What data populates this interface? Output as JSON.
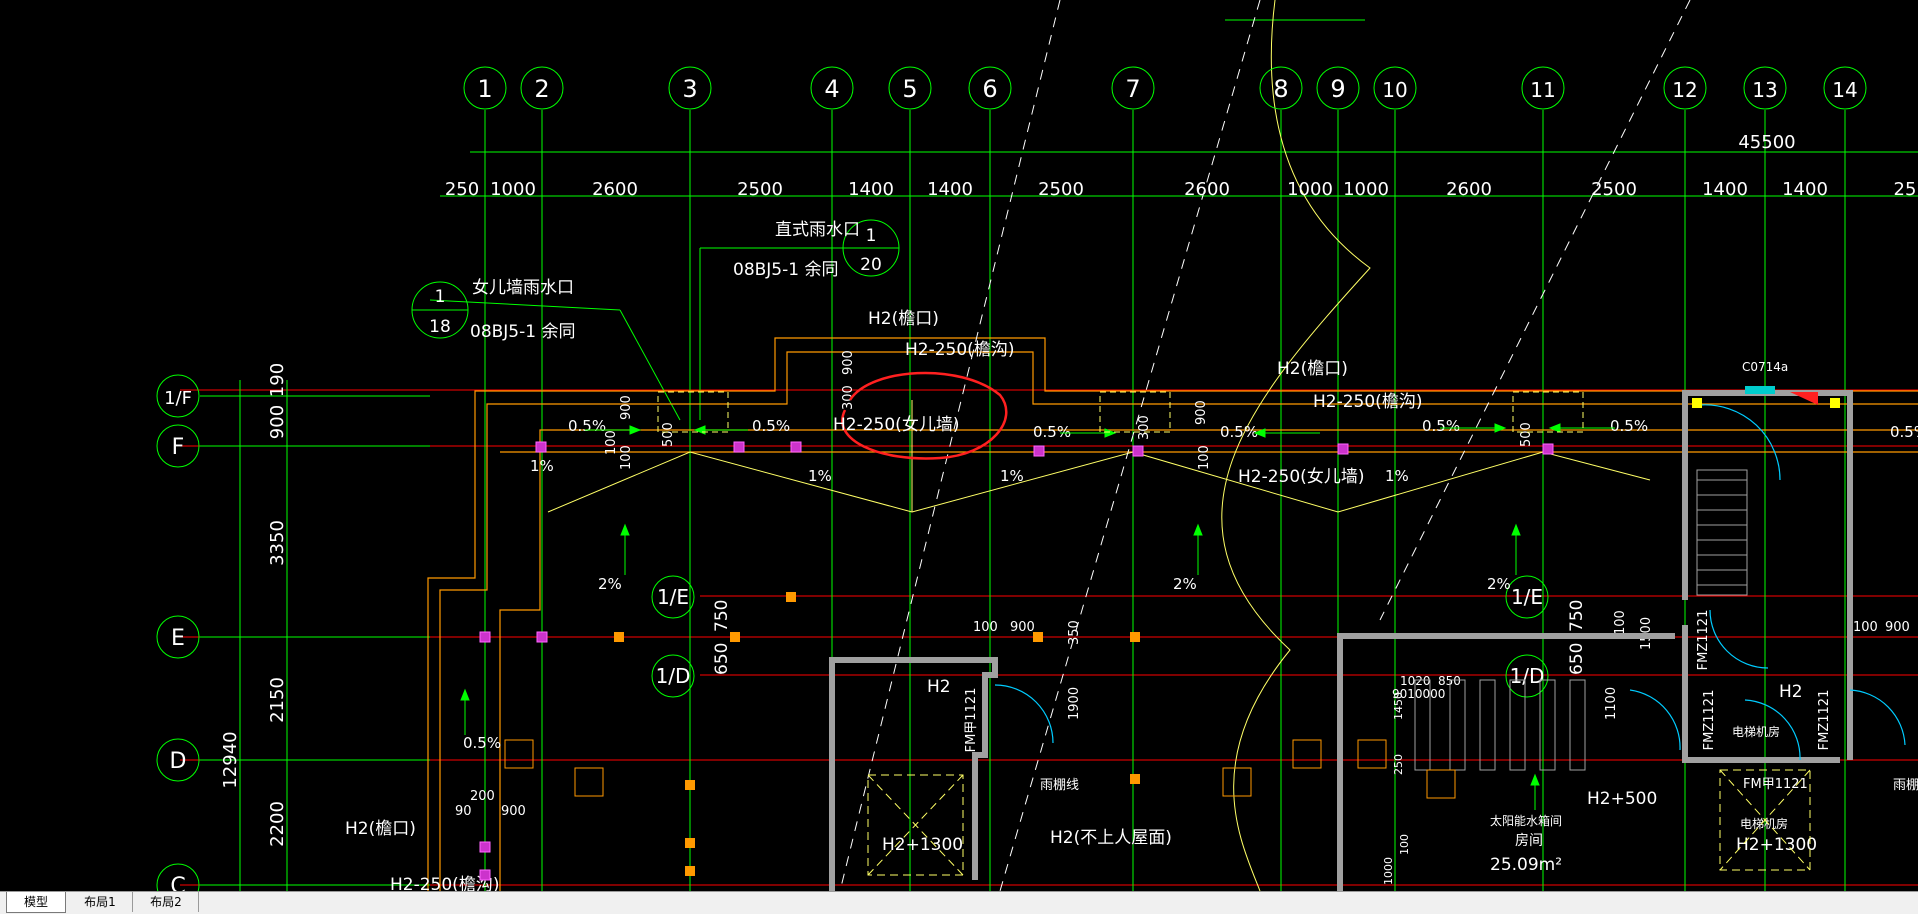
{
  "axes_top": [
    "1",
    "2",
    "3",
    "4",
    "5",
    "6",
    "7",
    "8",
    "9",
    "10",
    "11",
    "12",
    "13",
    "14"
  ],
  "axes_left": [
    "1/F",
    "F",
    "E",
    "D",
    "C"
  ],
  "axes_inner": [
    "1/E",
    "1/D",
    "1/E",
    "1/D"
  ],
  "dim_total": "45500",
  "dim_segments": [
    "250",
    "1000",
    "2600",
    "2500",
    "1400",
    "1400",
    "2500",
    "2600",
    "1000",
    "1000",
    "2600",
    "2500",
    "1400",
    "1400",
    "25"
  ],
  "dim_left": [
    "190",
    "900",
    "3350",
    "2150",
    "2200"
  ],
  "dim_left_total": "12940",
  "labels": {
    "rain_outlet_direct": "直式雨水口",
    "rain_outlet_parapet": "女儿墙雨水口",
    "ref_08bj": "08BJ5-1 余同",
    "ref_08bj_b": "08BJ5-1 余同",
    "detail_20_num": "1",
    "detail_20_den": "20",
    "detail_18_num": "1",
    "detail_18_den": "18",
    "h2_eave": "H2(檐口)",
    "h2_eave_b": "H2(檐口)",
    "h2_eave_c": "H2(檐口)",
    "h2_gutter": "H2-250(檐沟)",
    "h2_gutter_b": "H2-250(檐沟)",
    "h2_gutter_c": "H2-250(檐沟)",
    "h2_parapet": "H2-250(女儿墙)",
    "h2_parapet_b": "H2-250(女儿墙)",
    "h2_plain": "H2",
    "h2_plain_b": "H2",
    "h2_1300": "H2+1300",
    "h2_1300_b": "H2+1300",
    "h2_500": "H2+500",
    "h2_no_access": "H2(不上人屋面)",
    "door_fm1": "FM甲1121",
    "door_fm2": "FMZ1121",
    "door_fm3": "FMZ1121",
    "door_fm4": "FMZ1121",
    "door_fm5": "FM甲1121",
    "window_c": "C0714a",
    "rain_line": "雨棚线",
    "rain_line_b": "雨棚线",
    "elevator_room": "电梯机房",
    "elevator_room_b": "电梯机房",
    "solar_room_1": "太阳能水箱间",
    "solar_room_2": "房间",
    "area": "25.09m²"
  },
  "slopes": {
    "half_pct": "0.5%",
    "one_pct": "1%",
    "two_pct": "2%"
  },
  "small_dims": {
    "d900": "900",
    "d100": "100",
    "d500": "500",
    "d300": "300",
    "d750": "750",
    "d650": "650",
    "d350": "350",
    "d1900": "1900",
    "d200": "200",
    "d90": "90",
    "d1100": "1100",
    "d1450": "1450",
    "d250": "250",
    "d1020": "1020",
    "d850": "850",
    "d9010": "9010000",
    "d1500": "1500",
    "d1000": "1000"
  },
  "tabs": [
    "模型",
    "布局1",
    "布局2"
  ],
  "colors": {
    "background": "#000000",
    "axis_green": "#00ff00",
    "grid_red": "#ff0000",
    "wall_orange": "#ff9900",
    "roof_yellow": "#ffff66",
    "text_white": "#ffffff",
    "annotation_red": "#ff2020",
    "column_magenta": "#cc33cc",
    "wall_gray": "#a0a0a0"
  }
}
